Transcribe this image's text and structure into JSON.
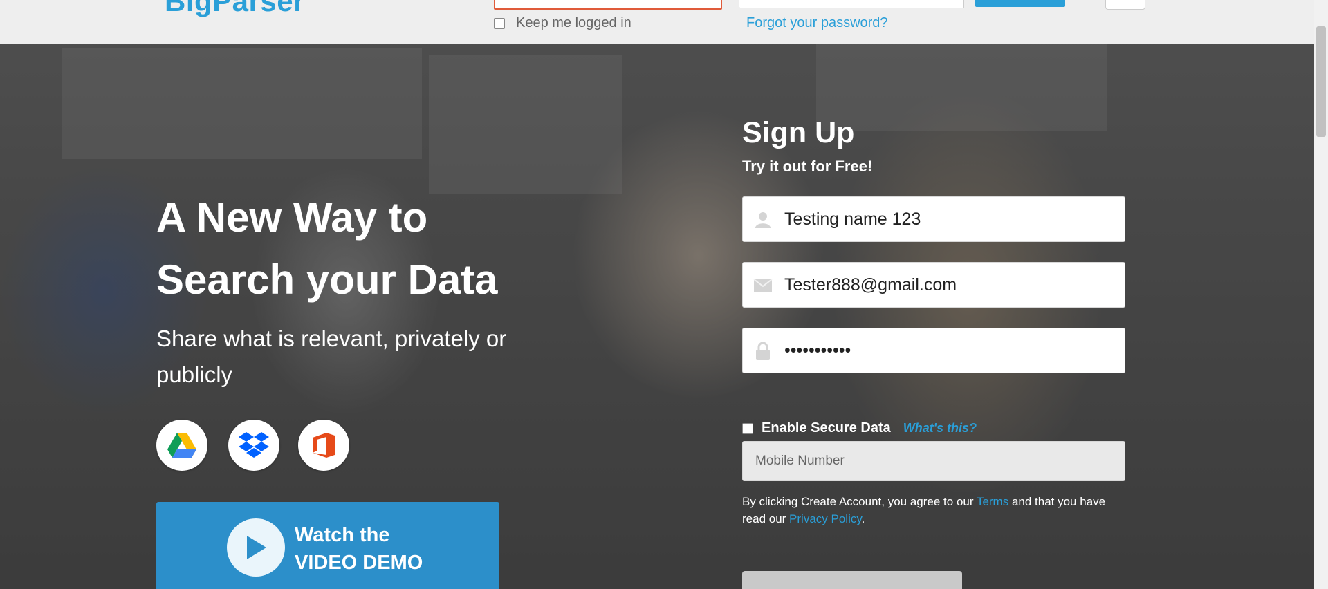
{
  "brand": {
    "logo_text": "BigParser"
  },
  "login_bar": {
    "keep_logged_in_label": "Keep me logged in",
    "forgot_password_label": "Forgot your password?"
  },
  "hero": {
    "headline_line1": "A New Way to",
    "headline_line2": "Search your Data",
    "subline": "Share what is relevant, privately or publicly",
    "services": [
      "google-drive-icon",
      "dropbox-icon",
      "office-icon"
    ],
    "demo_line1": "Watch the",
    "demo_line2": "VIDEO DEMO"
  },
  "signup": {
    "title": "Sign Up",
    "subtitle": "Try it out for Free!",
    "name_value": "Testing name 123",
    "email_value": "Tester888@gmail.com",
    "password_value": "•••••••••••",
    "secure_label": "Enable Secure Data",
    "whats_this": "What's this?",
    "mobile_placeholder": "Mobile Number",
    "terms_prefix": "By clicking Create Account, you agree to our ",
    "terms_link": "Terms",
    "terms_middle": " and that you have read our ",
    "privacy_link": "Privacy Policy",
    "terms_suffix": "."
  },
  "colors": {
    "accent": "#2a9fd8",
    "demo_button": "#2c8fca",
    "error_border": "#e05b3a"
  }
}
